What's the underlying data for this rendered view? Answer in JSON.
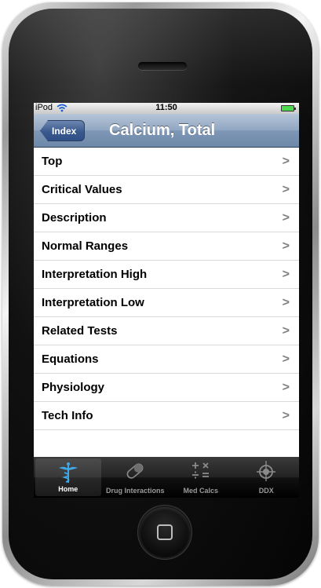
{
  "status_bar": {
    "carrier": "iPod",
    "time": "11:50"
  },
  "nav": {
    "back_label": "Index",
    "title": "Calcium, Total"
  },
  "list_items": [
    {
      "label": "Top"
    },
    {
      "label": "Critical Values"
    },
    {
      "label": "Description"
    },
    {
      "label": "Normal Ranges"
    },
    {
      "label": "Interpretation High"
    },
    {
      "label": "Interpretation Low"
    },
    {
      "label": "Related Tests"
    },
    {
      "label": "Equations"
    },
    {
      "label": "Physiology"
    },
    {
      "label": "Tech Info"
    }
  ],
  "chevron": ">",
  "tabs": [
    {
      "label": "Home",
      "icon": "caduceus-icon",
      "active": true
    },
    {
      "label": "Drug Interactions",
      "icon": "pill-icon",
      "active": false
    },
    {
      "label": "Med Calcs",
      "icon": "math-operators-icon",
      "active": false
    },
    {
      "label": "DDX",
      "icon": "crosshair-icon",
      "active": false
    }
  ],
  "colors": {
    "nav_bar": "#7e97b6",
    "back_button": "#3a5a8e",
    "tab_active_icon": "#3fa9e8",
    "battery": "#4cd94c"
  }
}
